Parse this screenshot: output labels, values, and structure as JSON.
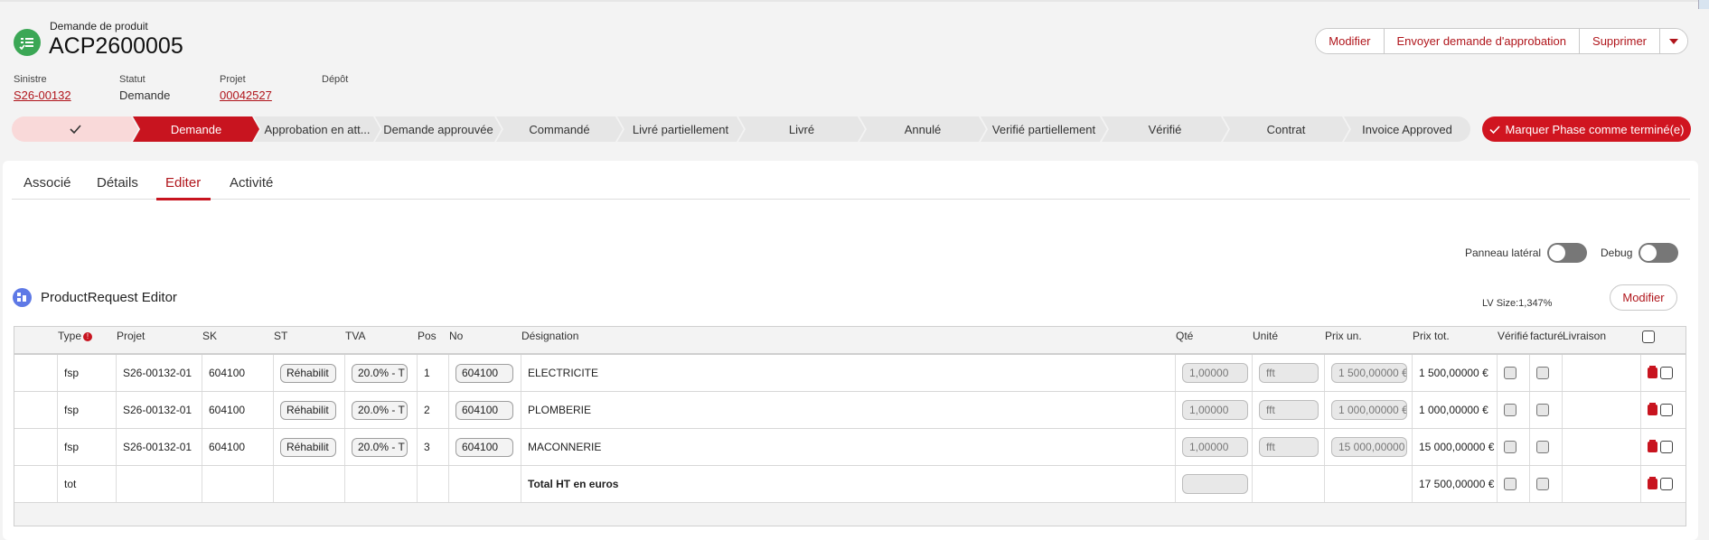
{
  "header": {
    "object_type": "Demande de produit",
    "record_name": "ACP2600005",
    "fields": [
      {
        "label": "Sinistre",
        "value": "S26-00132",
        "link": true
      },
      {
        "label": "Statut",
        "value": "Demande",
        "link": false
      },
      {
        "label": "Projet",
        "value": "00042527",
        "link": true
      },
      {
        "label": "Dépôt",
        "value": "",
        "link": false
      }
    ],
    "actions": [
      "Modifier",
      "Envoyer demande d'approbation",
      "Supprimer"
    ]
  },
  "path": {
    "stages": [
      "",
      "Demande",
      "Approbation en att...",
      "Demande approuvée",
      "Commandé",
      "Livré partiellement",
      "Livré",
      "Annulé",
      "Verifié partiellement",
      "Vérifié",
      "Contrat",
      "Invoice Approved"
    ],
    "current_index": 1,
    "mark_button": "Marquer Phase comme terminé(e)"
  },
  "tabs": [
    "Associé",
    "Détails",
    "Editer",
    "Activité"
  ],
  "active_tab": "Editer",
  "toggles": {
    "side_panel": "Panneau latéral",
    "debug": "Debug"
  },
  "editor": {
    "title": "ProductRequest Editor",
    "lv_size": "LV Size:1,347%",
    "modify_label": "Modifier"
  },
  "table": {
    "columns": [
      "Type",
      "Projet",
      "SK",
      "ST",
      "TVA",
      "Pos",
      "No",
      "Désignation",
      "Qté",
      "Unité",
      "Prix un.",
      "Prix tot.",
      "Vérifié",
      "facturé",
      "Livraison"
    ],
    "rows": [
      {
        "type": "fsp",
        "projet": "S26-00132-01",
        "sk": "604100",
        "st": "Réhabilit",
        "tva": "20.0% - T",
        "pos": "1",
        "no": "604100",
        "designation": "ELECTRICITE",
        "qte": "1,00000",
        "unite": "fft",
        "prix_un": "1 500,00000 €",
        "prix_tot": "1 500,00000 €"
      },
      {
        "type": "fsp",
        "projet": "S26-00132-01",
        "sk": "604100",
        "st": "Réhabilit",
        "tva": "20.0% - T",
        "pos": "2",
        "no": "604100",
        "designation": "PLOMBERIE",
        "qte": "1,00000",
        "unite": "fft",
        "prix_un": "1 000,00000 €",
        "prix_tot": "1 000,00000 €"
      },
      {
        "type": "fsp",
        "projet": "S26-00132-01",
        "sk": "604100",
        "st": "Réhabilit",
        "tva": "20.0% - T",
        "pos": "3",
        "no": "604100",
        "designation": "MACONNERIE",
        "qte": "1,00000",
        "unite": "fft",
        "prix_un": "15 000,00000",
        "prix_tot": "15 000,00000 €"
      }
    ],
    "total": {
      "type": "tot",
      "designation": "Total HT en euros",
      "prix_tot": "17 500,00000 €"
    }
  },
  "colors": {
    "accent": "#c8141f",
    "success": "#3ba755",
    "editor_icon": "#5e79e6"
  }
}
